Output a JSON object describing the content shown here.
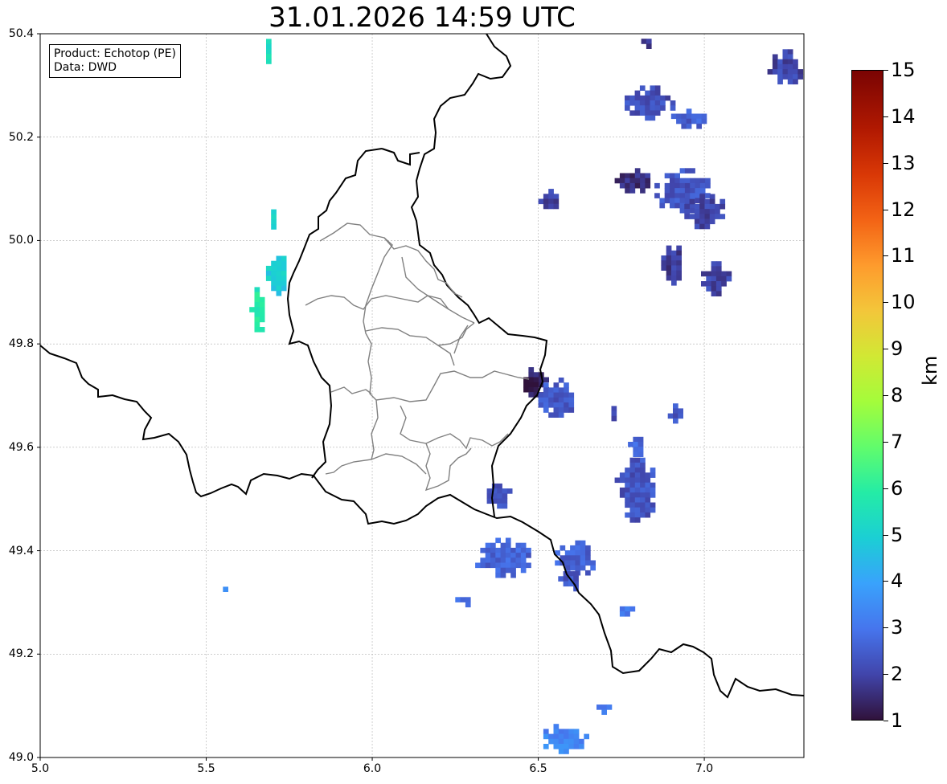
{
  "title": "31.01.2026 14:59 UTC",
  "info_box": {
    "product": "Product: Echotop (PE)",
    "data": "Data: DWD"
  },
  "axes": {
    "lon_range": [
      5.0,
      7.3
    ],
    "lat_range": [
      49.0,
      50.4
    ],
    "x_ticks": [
      "5.0",
      "5.5",
      "6.0",
      "6.5",
      "7.0"
    ],
    "y_ticks": [
      "50.4",
      "50.2",
      "50.0",
      "49.8",
      "49.6",
      "49.4",
      "49.2",
      "49.0"
    ],
    "grid": true
  },
  "colorbar": {
    "label": "km",
    "range": [
      1,
      15
    ],
    "ticks": [
      "15",
      "14",
      "13",
      "12",
      "11",
      "10",
      "9",
      "8",
      "7",
      "6",
      "5",
      "4",
      "3",
      "2",
      "1"
    ],
    "colormap": "turbo"
  },
  "colors": {
    "border": "#000000",
    "admin_border": "#808080",
    "echo_dark": "#35195c",
    "echo_mid": "#3e4aaf",
    "echo_blue": "#4682ee",
    "echo_cyan": "#1ecbd6",
    "echo_green": "#4cf07c"
  },
  "echo_cells": [
    {
      "lon": 6.83,
      "lat": 50.27,
      "rlon": 0.07,
      "rlat": 0.03,
      "value": 2.2
    },
    {
      "lon": 6.95,
      "lat": 50.24,
      "rlon": 0.05,
      "rlat": 0.015,
      "value": 2.5
    },
    {
      "lon": 6.78,
      "lat": 50.12,
      "rlon": 0.05,
      "rlat": 0.02,
      "value": 1.6
    },
    {
      "lon": 6.93,
      "lat": 50.1,
      "rlon": 0.08,
      "rlat": 0.04,
      "value": 2.3
    },
    {
      "lon": 7.0,
      "lat": 50.06,
      "rlon": 0.06,
      "rlat": 0.03,
      "value": 2.0
    },
    {
      "lon": 6.9,
      "lat": 49.96,
      "rlon": 0.03,
      "rlat": 0.04,
      "value": 1.8
    },
    {
      "lon": 7.03,
      "lat": 49.93,
      "rlon": 0.04,
      "rlat": 0.03,
      "value": 2.0
    },
    {
      "lon": 6.53,
      "lat": 50.08,
      "rlon": 0.03,
      "rlat": 0.02,
      "value": 2.0
    },
    {
      "lon": 6.48,
      "lat": 49.73,
      "rlon": 0.04,
      "rlat": 0.025,
      "value": 1.3
    },
    {
      "lon": 6.55,
      "lat": 49.7,
      "rlon": 0.05,
      "rlat": 0.035,
      "value": 2.4
    },
    {
      "lon": 6.79,
      "lat": 49.52,
      "rlon": 0.06,
      "rlat": 0.06,
      "value": 2.3
    },
    {
      "lon": 6.79,
      "lat": 49.61,
      "rlon": 0.02,
      "rlat": 0.02,
      "value": 2.6
    },
    {
      "lon": 6.39,
      "lat": 49.39,
      "rlon": 0.08,
      "rlat": 0.035,
      "value": 2.6
    },
    {
      "lon": 6.37,
      "lat": 49.51,
      "rlon": 0.04,
      "rlat": 0.02,
      "value": 2.4
    },
    {
      "lon": 6.61,
      "lat": 49.39,
      "rlon": 0.06,
      "rlat": 0.03,
      "value": 2.6
    },
    {
      "lon": 6.59,
      "lat": 49.35,
      "rlon": 0.03,
      "rlat": 0.02,
      "value": 2.4
    },
    {
      "lon": 6.76,
      "lat": 49.29,
      "rlon": 0.03,
      "rlat": 0.012,
      "value": 2.9
    },
    {
      "lon": 6.57,
      "lat": 49.04,
      "rlon": 0.07,
      "rlat": 0.025,
      "value": 3.3
    },
    {
      "lon": 6.69,
      "lat": 49.1,
      "rlon": 0.03,
      "rlat": 0.012,
      "value": 3.2
    },
    {
      "lon": 6.82,
      "lat": 50.39,
      "rlon": 0.01,
      "rlat": 0.01,
      "value": 1.8
    },
    {
      "lon": 7.24,
      "lat": 50.34,
      "rlon": 0.05,
      "rlat": 0.03,
      "value": 2.0
    },
    {
      "lon": 5.71,
      "lat": 49.94,
      "rlon": 0.03,
      "rlat": 0.04,
      "value": 4.9
    },
    {
      "lon": 5.65,
      "lat": 49.87,
      "rlon": 0.02,
      "rlat": 0.04,
      "value": 5.8
    },
    {
      "lon": 5.68,
      "lat": 50.37,
      "rlon": 0.015,
      "rlat": 0.02,
      "value": 5.4
    },
    {
      "lon": 5.69,
      "lat": 50.05,
      "rlon": 0.01,
      "rlat": 0.02,
      "value": 5.0
    },
    {
      "lon": 6.27,
      "lat": 49.31,
      "rlon": 0.02,
      "rlat": 0.01,
      "value": 2.8
    },
    {
      "lon": 5.55,
      "lat": 49.33,
      "rlon": 0.015,
      "rlat": 0.01,
      "value": 3.2
    },
    {
      "lon": 6.91,
      "lat": 49.67,
      "rlon": 0.02,
      "rlat": 0.015,
      "value": 2.3
    },
    {
      "lon": 6.72,
      "lat": 49.67,
      "rlon": 0.015,
      "rlat": 0.01,
      "value": 2.1
    }
  ]
}
